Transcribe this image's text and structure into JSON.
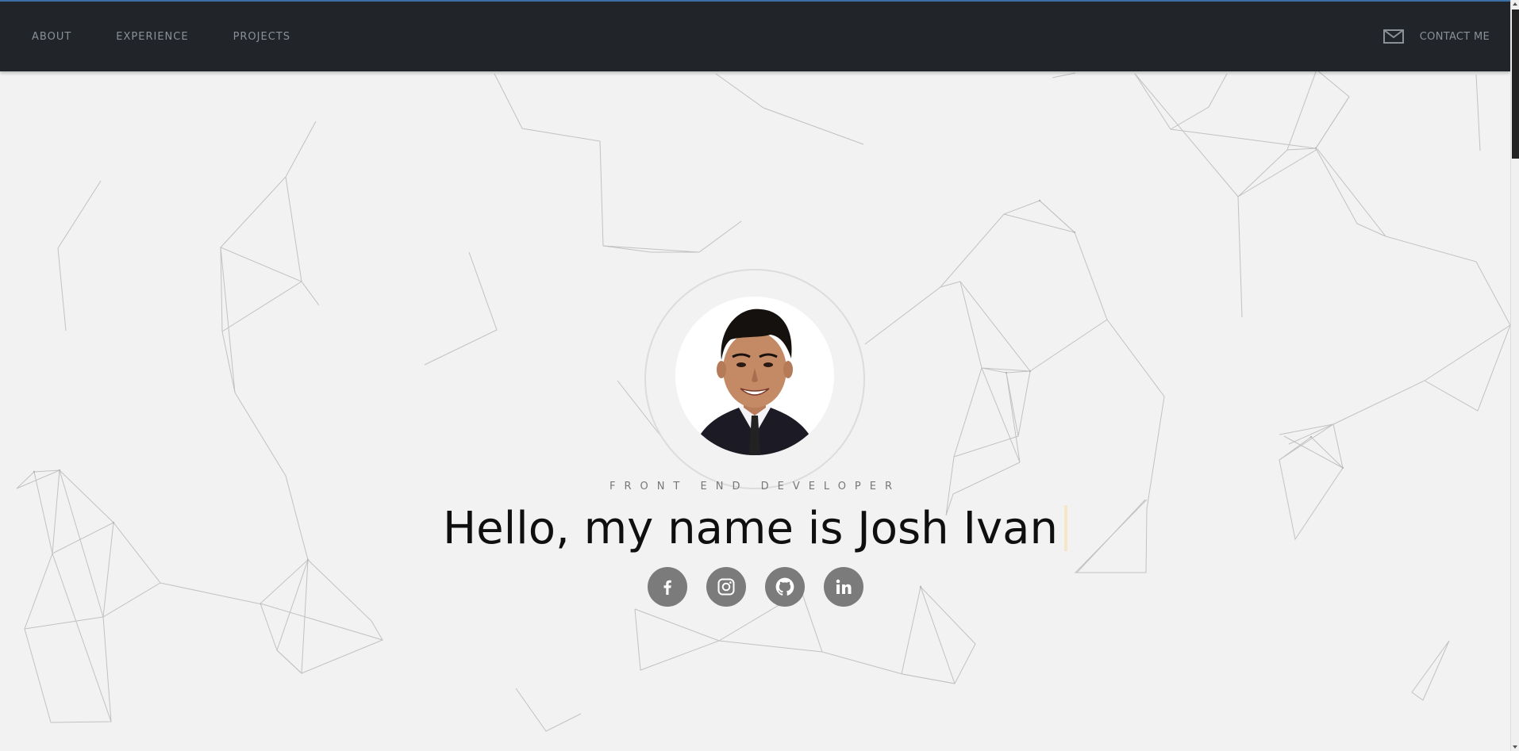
{
  "nav": {
    "items": [
      {
        "label": "ABOUT"
      },
      {
        "label": "EXPERIENCE"
      },
      {
        "label": "PROJECTS"
      }
    ],
    "contact_label": "CONTACT ME",
    "contact_icon": "mail-icon"
  },
  "hero": {
    "role": "FRONT END DEVELOPER",
    "greeting": "Hello, my name is Josh Ivan",
    "avatar_alt": "profile photo",
    "socials": [
      {
        "name": "facebook-icon"
      },
      {
        "name": "instagram-icon"
      },
      {
        "name": "github-icon"
      },
      {
        "name": "linkedin-icon"
      }
    ]
  },
  "colors": {
    "navbar": "#212529",
    "nav_text": "#8a9096",
    "background": "#f2f2f2",
    "social_button": "#7b7b7b",
    "cursor": "#f5e6c8"
  }
}
